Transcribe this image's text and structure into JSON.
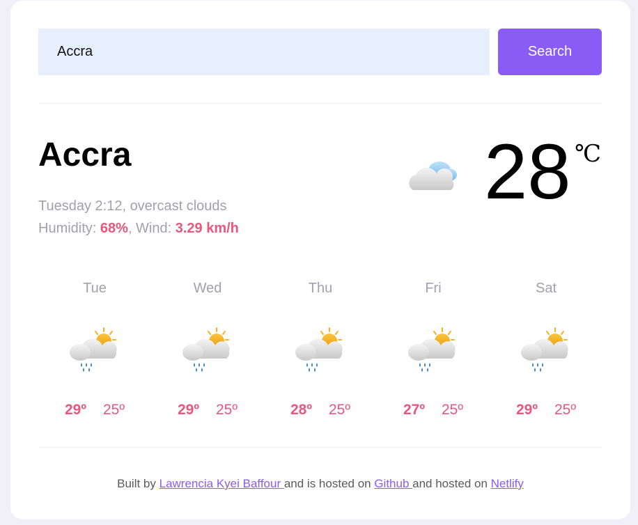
{
  "search": {
    "value": "Accra",
    "button_label": "Search"
  },
  "current": {
    "city": "Accra",
    "description": "Tuesday 2:12, overcast clouds",
    "humidity_label": "Humidity: ",
    "humidity_value": "68%",
    "wind_label": ", Wind: ",
    "wind_value": "3.29 km/h",
    "temperature": "28",
    "unit": "℃",
    "icon": "overcast-clouds-icon"
  },
  "forecast": [
    {
      "day": "Tue",
      "max": "29º",
      "min": "25º",
      "icon": "light-rain-sun-icon"
    },
    {
      "day": "Wed",
      "max": "29º",
      "min": "25º",
      "icon": "light-rain-sun-icon"
    },
    {
      "day": "Thu",
      "max": "28º",
      "min": "25º",
      "icon": "light-rain-sun-icon"
    },
    {
      "day": "Fri",
      "max": "27º",
      "min": "25º",
      "icon": "light-rain-sun-icon"
    },
    {
      "day": "Sat",
      "max": "29º",
      "min": "25º",
      "icon": "light-rain-sun-icon"
    }
  ],
  "footer": {
    "built_by": "Built by ",
    "author": "Lawrencia Kyei Baffour ",
    "middle": "and is hosted on ",
    "github": "Github ",
    "and_hosted": "and hosted on ",
    "netlify": "Netlify"
  },
  "colors": {
    "accent": "#8a5cf6",
    "highlight": "#e8577e",
    "muted": "#a3a0ad",
    "input_bg": "#e7effd"
  }
}
